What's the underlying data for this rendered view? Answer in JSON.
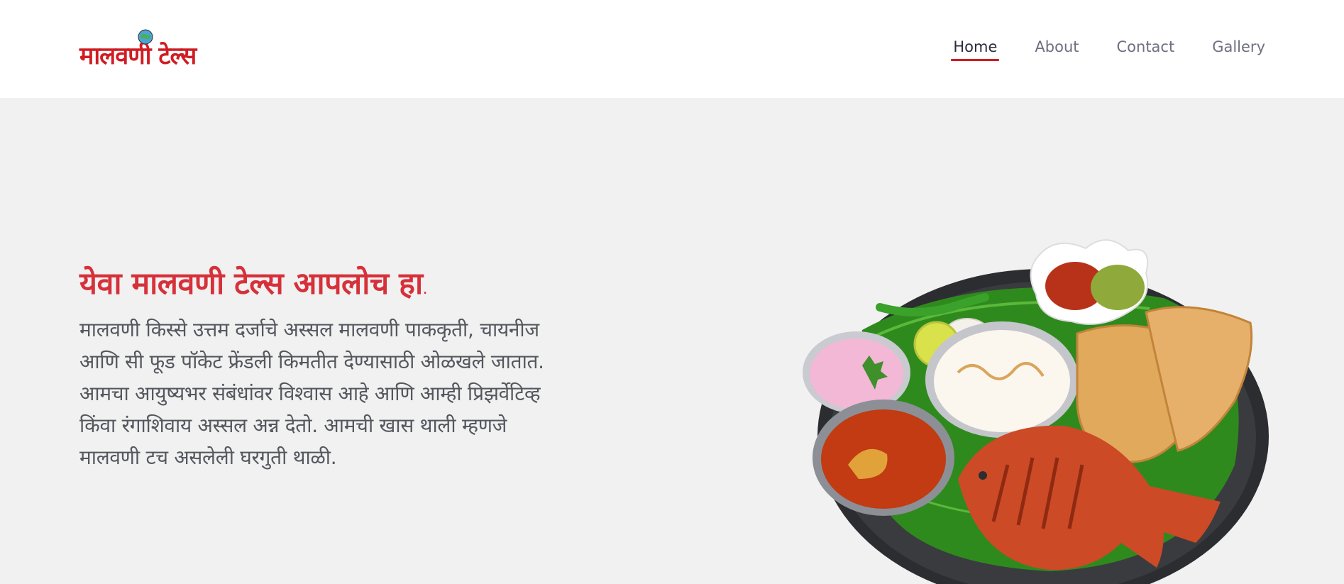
{
  "header": {
    "logo_text": "मालवणी टेल्स",
    "nav": [
      {
        "label": "Home",
        "active": true
      },
      {
        "label": "About",
        "active": false
      },
      {
        "label": "Contact",
        "active": false
      },
      {
        "label": "Gallery",
        "active": false
      }
    ]
  },
  "hero": {
    "title": "येवा मालवणी टेल्स आपलोच हा",
    "title_dot": ".",
    "body": "मालवणी किस्से उत्तम दर्जाचे अस्सल मालवणी पाककृती, चायनीज आणि सी फूड पॉकेट फ्रेंडली किमतीत देण्यासाठी ओळखले जातात. आमचा आयुष्यभर संबंधांवर विश्वास आहे आणि आम्ही प्रिझर्वेटिव्ह किंवा रंगाशिवाय अस्सल अन्न देतो. आमची खास थाली म्हणजे मालवणी टच असलेली घरगुती थाळी."
  },
  "colors": {
    "brand_red": "#d01c23",
    "title_red": "#d6313a",
    "background": "#f1f1f1"
  },
  "icons": {
    "logo_globe": "globe-icon",
    "thali_image": "malvani-thali-photo"
  }
}
